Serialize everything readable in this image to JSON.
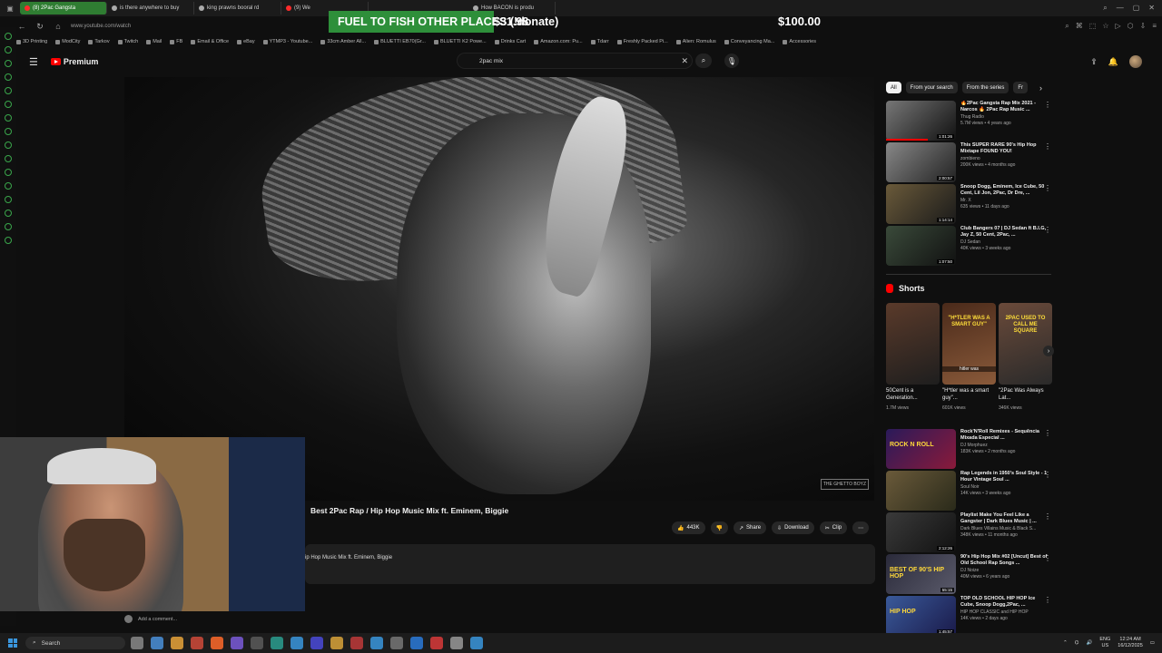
{
  "browser": {
    "tabs": [
      {
        "label": "(8) 2Pac Gangsta",
        "active": true,
        "color": "#ff2b2b"
      },
      {
        "label": "is there anywhere to buy",
        "active": false,
        "color": "#aaaaaa"
      },
      {
        "label": "king prawns booral rd",
        "active": false,
        "color": "#aaaaaa"
      },
      {
        "label": "(9) We",
        "active": false,
        "color": "#ff2b2b"
      },
      {
        "label": "How BACON is produ",
        "active": false,
        "color": "#aaaaaa"
      }
    ],
    "url": "www.youtube.com/watch",
    "bookmarks": [
      "3D Printing",
      "ModCity",
      "Tarkov",
      "Twitch",
      "Mail",
      "FB",
      "Email & Office",
      "eBay",
      "YTMP3 - Youtube...",
      "33cm Amber All...",
      "BLUETTI EB70(Gr...",
      "BLUETTI K2 Powe...",
      "Drinks Cart",
      "Amazon.com: Pu...",
      "Tdarr",
      "Freshly Packed Pi...",
      "Alien: Romulus",
      "Conveyancing Ma...",
      "Accessories"
    ]
  },
  "overlay": {
    "donate_label": "FUEL TO FISH OTHER PLACES (!donate)",
    "donate_amount": "$31.98",
    "goal_amount": "$100.00"
  },
  "youtube": {
    "logo_text": "Premium",
    "search_value": "2pac mix",
    "video_title": "Best 2Pac Rap / Hip Hop Music Mix ft. Eminem, Biggie",
    "likes": "443K",
    "share_label": "Share",
    "download_label": "Download",
    "clip_label": "Clip",
    "description": "ip Hop Music Mix ft. Eminem, Biggie",
    "add_comment": "Add a comment...",
    "watermark": "THE GHETTO BOYZ"
  },
  "chips": [
    "All",
    "From your search",
    "From the series",
    "Fr"
  ],
  "recommendations": [
    {
      "title": "🔥2Pac Gangsta Rap Mix 2021 - Narcos 🔥 2Pac Rap Music ...",
      "channel": "Thug Radio",
      "meta": "5.7M views • 4 years ago",
      "duration": "1:01:26",
      "progress": 0.6
    },
    {
      "title": "This SUPER RARE 90's Hip Hop Mixtape FOUND YOU!",
      "channel": "zombieno",
      "meta": "200K views • 4 months ago",
      "duration": "2:00:57",
      "progress": 0
    },
    {
      "title": "Snoop Dogg, Eminem, Ice Cube, 50 Cent, Lil Jon, 2Pac, Dr Dre, ...",
      "channel": "Mr. X",
      "meta": "635 views • 11 days ago",
      "duration": "1:14:14",
      "progress": 0
    },
    {
      "title": "Club Bangers 07 | DJ Sedan ft B.I.G, Jay Z, 50 Cent, 2Pac, ...",
      "channel": "DJ Sedan",
      "meta": "40K views • 3 weeks ago",
      "duration": "1:07:50",
      "progress": 0
    }
  ],
  "shorts_label": "Shorts",
  "shorts": [
    {
      "title": "50Cent is a Generation...",
      "views": "1.7M views",
      "caption": "",
      "sub": ""
    },
    {
      "title": "\"H*tler was a smart guy\"...",
      "views": "601K views",
      "caption": "\"H*TLER WAS A SMART GUY\"",
      "sub": "hitler was"
    },
    {
      "title": "\"2Pac Was Always Lat...",
      "views": "346K views",
      "caption": "2PAC USED TO CALL ME SQUARE",
      "sub": ""
    }
  ],
  "recommendations2": [
    {
      "title": "Rock'N'Roll Remixes - Sequência Mixada Especial ...",
      "channel": "DJ Morphuez",
      "meta": "183K views • 2 months ago",
      "duration": "",
      "thumb_text": "ROCK N ROLL"
    },
    {
      "title": "Rap Legends in 1950's Soul Style - 1 Hour Vintage Soul ...",
      "channel": "Soul Noir",
      "meta": "14K views • 3 weeks ago",
      "duration": "",
      "thumb_text": ""
    },
    {
      "title": "Playlist Make You Feel Like a Gangster | Dark Blues Music | ...",
      "channel": "Dark Blues Villains Music & Black S...",
      "meta": "348K views • 11 months ago",
      "duration": "2:12:26",
      "thumb_text": ""
    },
    {
      "title": "90's Hip Hop Mix #02 [Uncut] Best of Old School Rap Songs ...",
      "channel": "DJ Noize",
      "meta": "40M views • 6 years ago",
      "duration": "55:15",
      "thumb_text": "BEST OF 90'S HIP HOP"
    },
    {
      "title": "TOP OLD SCHOOL HIP HOP Ice Cube, Snoop Dogg,2Pac, ...",
      "channel": "HIP HOP CLASSIC and HIP HOP",
      "meta": "14K views • 2 days ago",
      "duration": "1:45:57",
      "thumb_text": "HIP HOP"
    }
  ],
  "taskbar": {
    "search_label": "Search",
    "lang": "ENG\nUS",
    "time": "12:24 AM",
    "date": "16/12/2025"
  },
  "colors": {
    "accent": "#2e8f3a",
    "youtube_red": "#ff0000"
  }
}
